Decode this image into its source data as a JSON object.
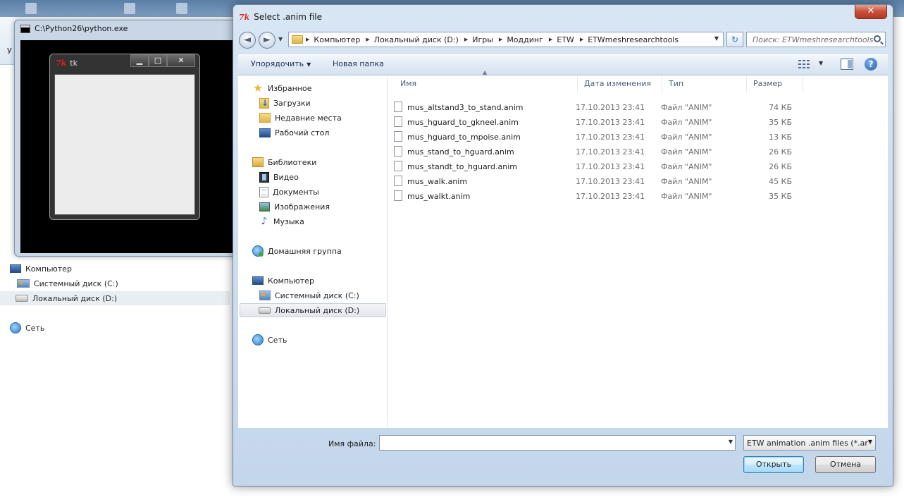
{
  "bg_explorer": {
    "partial_label": "У",
    "computer": "Компьютер",
    "drive_c": "Системный диск (C:)",
    "drive_d": "Локальный диск (D:)",
    "network": "Сеть"
  },
  "console": {
    "title": "C:\\Python26\\python.exe"
  },
  "tk_window": {
    "logo": "7k",
    "title": "tk",
    "minimize": "▁",
    "maximize": "□",
    "close": "✕"
  },
  "dialog": {
    "logo": "7k",
    "title": "Select .anim file",
    "close": "✕",
    "nav": {
      "back": "◄",
      "forward": "►",
      "dropdown": "▼",
      "breadcrumbs": [
        "Компьютер",
        "Локальный диск (D:)",
        "Игры",
        "Моддинг",
        "ETW",
        "ETWmeshresearchtools"
      ],
      "refresh": "↻",
      "search_placeholder": "Поиск: ETWmeshresearchtools"
    },
    "toolbar": {
      "organize": "Упорядочить",
      "new_folder": "Новая папка",
      "help": "?"
    },
    "sidebar": {
      "favorites": "Избранное",
      "downloads": "Загрузки",
      "recent": "Недавние места",
      "desktop": "Рабочий стол",
      "libraries": "Библиотеки",
      "video": "Видео",
      "documents": "Документы",
      "images": "Изображения",
      "music": "Музыка",
      "homegroup": "Домашняя группа",
      "computer": "Компьютер",
      "drive_c": "Системный диск (C:)",
      "drive_d": "Локальный диск (D:)",
      "network": "Сеть"
    },
    "columns": {
      "name": "Имя",
      "date": "Дата изменения",
      "type": "Тип",
      "size": "Размер"
    },
    "files": [
      {
        "name": "mus_altstand3_to_stand.anim",
        "date": "17.10.2013 23:41",
        "type": "Файл \"ANIM\"",
        "size": "74 КБ"
      },
      {
        "name": "mus_hguard_to_gkneel.anim",
        "date": "17.10.2013 23:41",
        "type": "Файл \"ANIM\"",
        "size": "35 КБ"
      },
      {
        "name": "mus_hguard_to_mpoise.anim",
        "date": "17.10.2013 23:41",
        "type": "Файл \"ANIM\"",
        "size": "13 КБ"
      },
      {
        "name": "mus_stand_to_hguard.anim",
        "date": "17.10.2013 23:41",
        "type": "Файл \"ANIM\"",
        "size": "26 КБ"
      },
      {
        "name": "mus_standt_to_hguard.anim",
        "date": "17.10.2013 23:41",
        "type": "Файл \"ANIM\"",
        "size": "26 КБ"
      },
      {
        "name": "mus_walk.anim",
        "date": "17.10.2013 23:41",
        "type": "Файл \"ANIM\"",
        "size": "45 КБ"
      },
      {
        "name": "mus_walkt.anim",
        "date": "17.10.2013 23:41",
        "type": "Файл \"ANIM\"",
        "size": "35 КБ"
      }
    ],
    "bottom": {
      "filename_label": "Имя файла:",
      "filename_value": "",
      "filetype": "ETW animation .anim files (*.ar",
      "open": "Открыть",
      "cancel": "Отмена"
    }
  }
}
